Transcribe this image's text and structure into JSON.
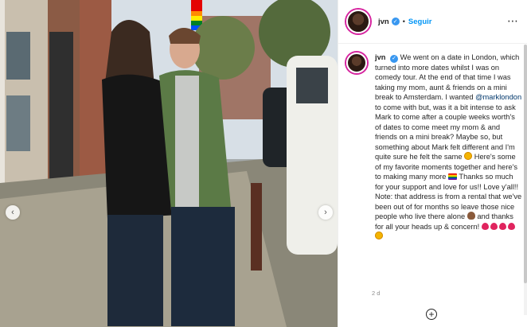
{
  "post": {
    "username": "jvn",
    "follow_label": "Seguir",
    "separator": "•",
    "more_icon": "⋯",
    "verified_icon": "✓",
    "caption_parts": {
      "p1": "We went on a date in London, which turned into more dates whilst I was on comedy tour. At the end of that time I was taking my mom, aunt & friends on a mini break to Amsterdam. I wanted ",
      "mention": "@marklondon",
      "p2": " to come with but, was it a bit intense to ask Mark to come after a couple weeks worth's of dates to come meet my mom & and friends on a mini break? Maybe so, but something about Mark felt different and I'm quite sure he felt the same ",
      "p3": " Here's some of my favorite moments together and here's to making many more ",
      "p4": " Thanks so much for your support and love for us!! Love y'all!! Note: that address is from a rental that we've been out of for months so leave those nice people who live there alone ",
      "p5": " and thanks for all your heads up & concern! "
    },
    "timestamp": "2 d",
    "add_comment_icon": "+"
  },
  "carousel": {
    "prev_icon": "‹",
    "next_icon": "›"
  },
  "colors": {
    "accent": "#0095f6",
    "verified": "#3897f0",
    "mention": "#00376b",
    "muted": "#8e8e8e"
  }
}
